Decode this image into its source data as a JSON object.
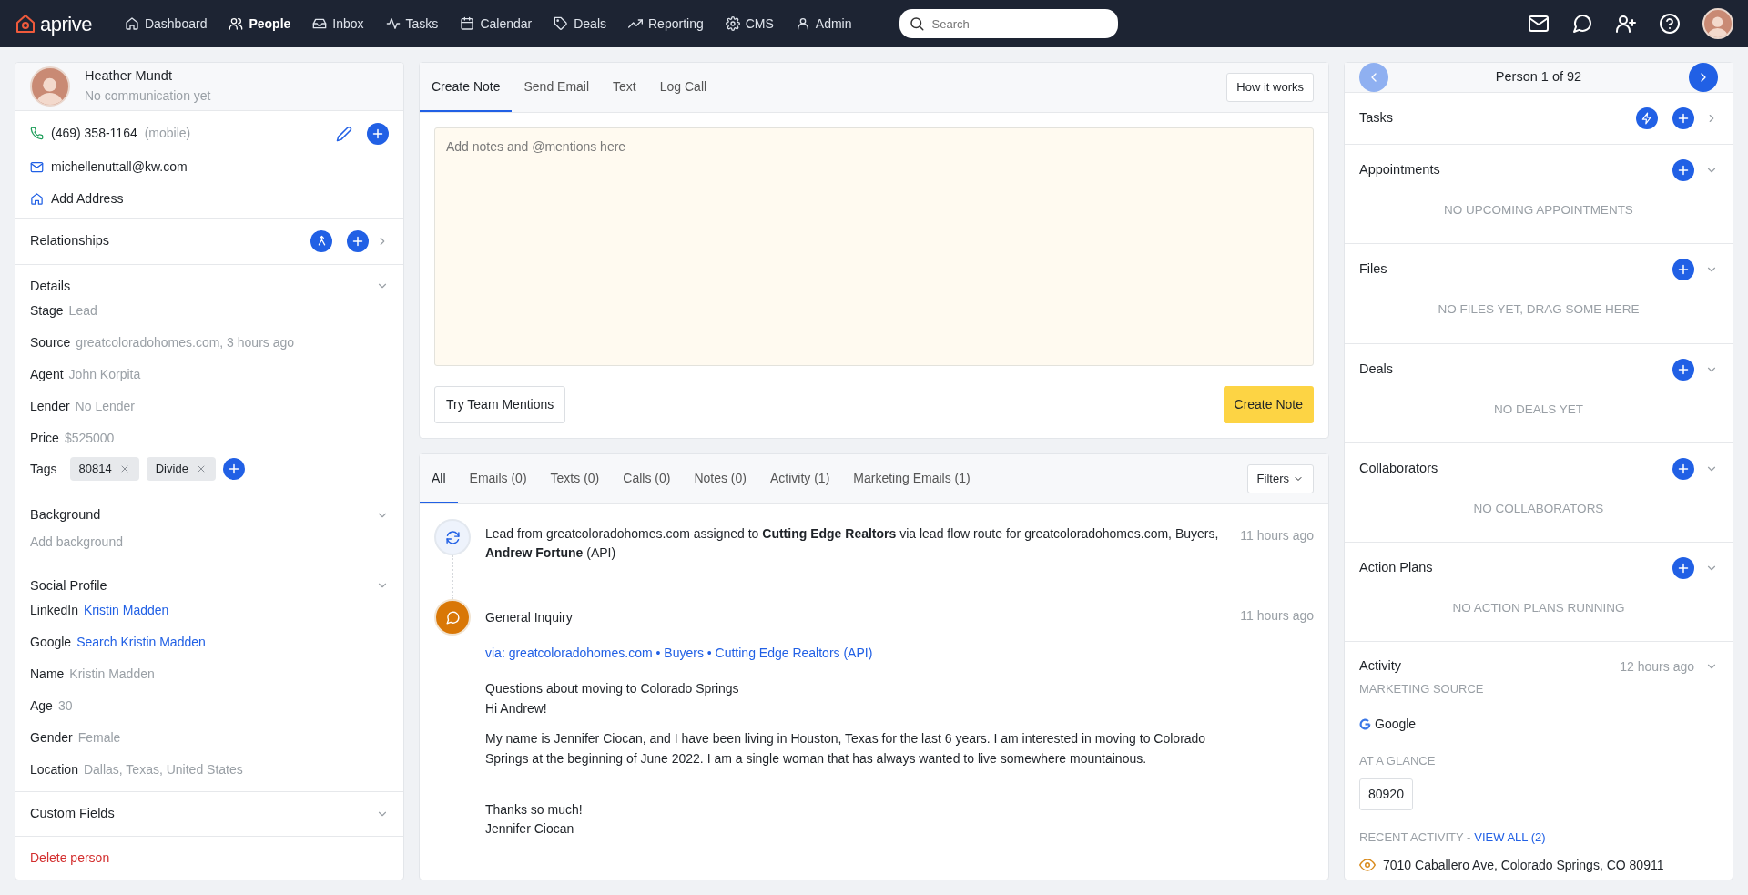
{
  "nav": {
    "logo": "aprive",
    "items": [
      {
        "label": "Dashboard",
        "selected": false
      },
      {
        "label": "People",
        "selected": true
      },
      {
        "label": "Inbox",
        "selected": false
      },
      {
        "label": "Tasks",
        "selected": false
      },
      {
        "label": "Calendar",
        "selected": false
      },
      {
        "label": "Deals",
        "selected": false
      },
      {
        "label": "Reporting",
        "selected": false
      },
      {
        "label": "CMS",
        "selected": false
      },
      {
        "label": "Admin",
        "selected": false
      }
    ],
    "search": {
      "placeholder": "Search"
    }
  },
  "person": {
    "name": "Heather Mundt",
    "status": "No communication yet",
    "phone": {
      "value": "(469) 358-1164",
      "note": "(mobile)"
    },
    "email": "michellenuttall@kw.com",
    "address": "Add Address",
    "relationships": {
      "title": "Relationships"
    },
    "details": {
      "title": "Details",
      "fields": [
        {
          "label": "Stage",
          "value": "Lead"
        },
        {
          "label": "Source",
          "value": "greatcoloradohomes.com, 3 hours ago"
        },
        {
          "label": "Agent",
          "value": "John Korpita"
        },
        {
          "label": "Lender",
          "value": "No Lender"
        },
        {
          "label": "Price",
          "value": "$525000"
        }
      ],
      "tags_label": "Tags",
      "tags": [
        "80814",
        "Divide"
      ]
    },
    "background": {
      "title": "Background",
      "placeholder": "Add background"
    },
    "social": {
      "title": "Social Profile",
      "fields": [
        {
          "label": "LinkedIn",
          "value": "Kristin Madden",
          "kind": "link"
        },
        {
          "label": "Google",
          "value": "Search Kristin Madden",
          "kind": "link"
        },
        {
          "label": "Name",
          "value": "Kristin Madden",
          "kind": "text"
        },
        {
          "label": "Age",
          "value": "30",
          "kind": "text"
        },
        {
          "label": "Gender",
          "value": "Female",
          "kind": "text"
        },
        {
          "label": "Location",
          "value": "Dallas, Texas, United States",
          "kind": "text"
        }
      ]
    },
    "custom_fields": {
      "title": "Custom Fields"
    },
    "delete": "Delete person"
  },
  "compose": {
    "tabs": [
      {
        "label": "Create Note",
        "selected": true
      },
      {
        "label": "Send Email",
        "selected": false
      },
      {
        "label": "Text",
        "selected": false
      },
      {
        "label": "Log Call",
        "selected": false
      }
    ],
    "help_button": "How it works",
    "placeholder": "Add notes and @mentions here",
    "mentions_button": "Try Team Mentions",
    "submit_button": "Create Note"
  },
  "feed": {
    "tabs": [
      {
        "label": "All",
        "selected": true
      },
      {
        "label": "Emails (0)",
        "selected": false
      },
      {
        "label": "Texts (0)",
        "selected": false
      },
      {
        "label": "Calls (0)",
        "selected": false
      },
      {
        "label": "Notes (0)",
        "selected": false
      },
      {
        "label": "Activity (1)",
        "selected": false
      },
      {
        "label": "Marketing Emails (1)",
        "selected": false
      }
    ],
    "filters": "Filters",
    "items": [
      {
        "kind": "assignment",
        "text": "Lead from greatcoloradohomes.com assigned to **Cutting Edge Realtors** via lead flow route for greatcoloradohomes.com, Buyers, **Andrew Fortune** (API)",
        "time": "11 hours ago"
      },
      {
        "kind": "inquiry",
        "title": "General Inquiry",
        "time": "11 hours ago",
        "via": "via: greatcoloradohomes.com • Buyers • Cutting Edge Realtors (API)",
        "paragraphs": [
          [
            "Questions about moving to Colorado Springs",
            "Hi Andrew!"
          ],
          [
            "My name is Jennifer Ciocan, and I have been living in Houston, Texas for the last 6 years. I am interested in moving to Colorado Springs at the beginning of June 2022. I am a single woman that has always wanted to live somewhere mountainous."
          ],
          [
            "Thanks so much!",
            "Jennifer Ciocan"
          ]
        ]
      }
    ]
  },
  "sidebar": {
    "pager": {
      "label": "Person 1 of 92",
      "prev_disabled": true,
      "next_disabled": false
    },
    "sections": [
      {
        "kind": "link",
        "title": "Tasks"
      },
      {
        "kind": "empty",
        "title": "Appointments",
        "empty": "NO UPCOMING APPOINTMENTS"
      },
      {
        "kind": "empty",
        "title": "Files",
        "empty": "NO FILES YET, DRAG SOME HERE"
      },
      {
        "kind": "empty",
        "title": "Deals",
        "empty": "NO DEALS YET"
      },
      {
        "kind": "empty",
        "title": "Collaborators",
        "empty": "NO COLLABORATORS"
      },
      {
        "kind": "empty",
        "title": "Action Plans",
        "empty": "NO ACTION PLANS RUNNING"
      },
      {
        "kind": "activity",
        "title": "Activity",
        "time": "12 hours ago",
        "source_label": "MARKETING SOURCE",
        "source": "Google",
        "glance_label": "AT A GLANCE",
        "glance_chips": [
          "80920"
        ],
        "recent_label": "RECENT ACTIVITY -",
        "recent_link": "VIEW ALL (2)",
        "recent_items": [
          "7010 Caballero Ave, Colorado Springs, CO 80911"
        ]
      }
    ]
  }
}
